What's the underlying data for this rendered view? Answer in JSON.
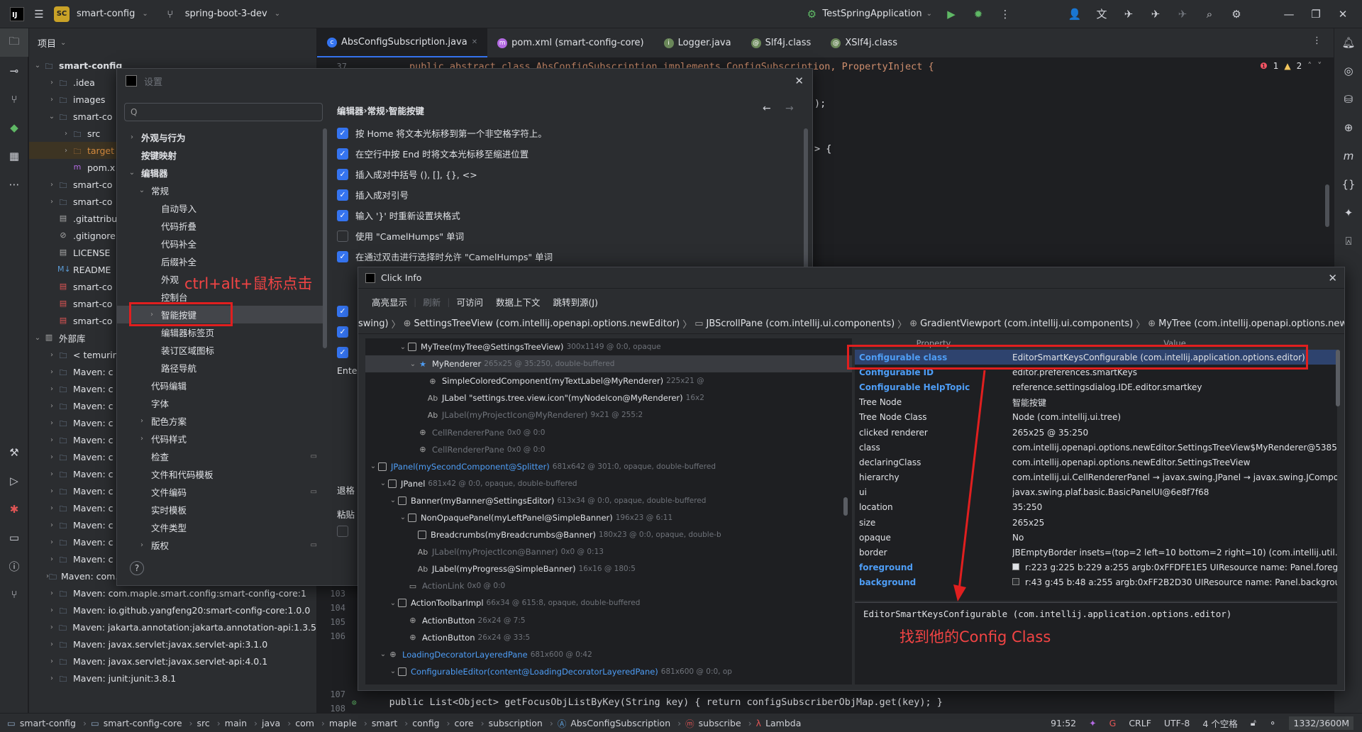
{
  "titlebar": {
    "project": "smart-config",
    "project_badge": "SC",
    "branch": "spring-boot-3-dev",
    "run_config": "TestSpringApplication"
  },
  "project_panel": {
    "title": "项目",
    "rows": [
      {
        "indent": 0,
        "arrow": "v",
        "icon": "folder",
        "label": "smart-config"
      },
      {
        "indent": 1,
        "arrow": ">",
        "icon": "folder",
        "label": ".idea"
      },
      {
        "indent": 1,
        "arrow": ">",
        "icon": "folder",
        "label": "images"
      },
      {
        "indent": 1,
        "arrow": "v",
        "icon": "folder",
        "label": "smart-co"
      },
      {
        "indent": 2,
        "arrow": ">",
        "icon": "folder",
        "label": "src"
      },
      {
        "indent": 2,
        "arrow": ">",
        "icon": "folder-orange",
        "label": "target"
      },
      {
        "indent": 2,
        "arrow": "",
        "icon": "maven",
        "label": "pom.x"
      },
      {
        "indent": 1,
        "arrow": ">",
        "icon": "folder",
        "label": "smart-co"
      },
      {
        "indent": 1,
        "arrow": ">",
        "icon": "folder",
        "label": "smart-co"
      },
      {
        "indent": 1,
        "arrow": "",
        "icon": "file",
        "label": ".gitattribu"
      },
      {
        "indent": 1,
        "arrow": "",
        "icon": "ignore",
        "label": ".gitignore"
      },
      {
        "indent": 1,
        "arrow": "",
        "icon": "file",
        "label": "LICENSE"
      },
      {
        "indent": 1,
        "arrow": "",
        "icon": "md",
        "label": "README"
      },
      {
        "indent": 1,
        "arrow": "",
        "icon": "file-red",
        "label": "smart-co"
      },
      {
        "indent": 1,
        "arrow": "",
        "icon": "file-red",
        "label": "smart-co"
      },
      {
        "indent": 1,
        "arrow": "",
        "icon": "file-red",
        "label": "smart-co"
      },
      {
        "indent": 0,
        "arrow": "v",
        "icon": "lib",
        "label": "外部库"
      },
      {
        "indent": 1,
        "arrow": ">",
        "icon": "folder",
        "label": "< temurin"
      },
      {
        "indent": 1,
        "arrow": ">",
        "icon": "folder",
        "label": "Maven: c"
      },
      {
        "indent": 1,
        "arrow": ">",
        "icon": "folder",
        "label": "Maven: c"
      },
      {
        "indent": 1,
        "arrow": ">",
        "icon": "folder",
        "label": "Maven: c"
      },
      {
        "indent": 1,
        "arrow": ">",
        "icon": "folder",
        "label": "Maven: c"
      },
      {
        "indent": 1,
        "arrow": ">",
        "icon": "folder",
        "label": "Maven: c"
      },
      {
        "indent": 1,
        "arrow": ">",
        "icon": "folder",
        "label": "Maven: c"
      },
      {
        "indent": 1,
        "arrow": ">",
        "icon": "folder",
        "label": "Maven: c"
      },
      {
        "indent": 1,
        "arrow": ">",
        "icon": "folder",
        "label": "Maven: c"
      },
      {
        "indent": 1,
        "arrow": ">",
        "icon": "folder",
        "label": "Maven: c"
      },
      {
        "indent": 1,
        "arrow": ">",
        "icon": "folder",
        "label": "Maven: c"
      },
      {
        "indent": 1,
        "arrow": ">",
        "icon": "folder",
        "label": "Maven: c"
      },
      {
        "indent": 1,
        "arrow": ">",
        "icon": "folder",
        "label": "Maven: c"
      },
      {
        "indent": 1,
        "arrow": ">",
        "icon": "folder",
        "label": "Maven: com.fasterxml.jackson.module:jackson-module-pa"
      },
      {
        "indent": 1,
        "arrow": ">",
        "icon": "folder",
        "label": "Maven: com.maple.smart.config:smart-config-core:1"
      },
      {
        "indent": 1,
        "arrow": ">",
        "icon": "folder",
        "label": "Maven: io.github.yangfeng20:smart-config-core:1.0.0"
      },
      {
        "indent": 1,
        "arrow": ">",
        "icon": "folder",
        "label": "Maven: jakarta.annotation:jakarta.annotation-api:1.3.5"
      },
      {
        "indent": 1,
        "arrow": ">",
        "icon": "folder",
        "label": "Maven: javax.servlet:javax.servlet-api:3.1.0"
      },
      {
        "indent": 1,
        "arrow": ">",
        "icon": "folder",
        "label": "Maven: javax.servlet:javax.servlet-api:4.0.1"
      },
      {
        "indent": 1,
        "arrow": ">",
        "icon": "folder",
        "label": "Maven: junit:junit:3.8.1"
      }
    ]
  },
  "editor": {
    "tabs": [
      {
        "label": "AbsConfigSubscription.java",
        "active": true,
        "color": "#3574f0",
        "glyph": "c"
      },
      {
        "label": "pom.xml (smart-config-core)",
        "active": false,
        "color": "#b36ae2",
        "glyph": "m"
      },
      {
        "label": "Logger.java",
        "active": false,
        "color": "#6a8759",
        "glyph": "i"
      },
      {
        "label": "Slf4j.class",
        "active": false,
        "color": "#6a8759",
        "glyph": "@"
      },
      {
        "label": "XSlf4j.class",
        "active": false,
        "color": "#6a8759",
        "glyph": "@"
      }
    ],
    "first_line_no": "37",
    "first_line": "public abstract class AbsConfigSubscription implements ConfigSubscription, PropertyInject {",
    "frag1": ");",
    "frag2": "> {",
    "inspection_errors": "1",
    "inspection_warnings": "2",
    "gutter_lines": [
      "103",
      "104",
      "105",
      "106",
      "",
      "107",
      "108"
    ],
    "last_line": "public List<Object> getFocusObjListByKey(String key) { return configSubscriberObjMap.get(key); }"
  },
  "statusbar": {
    "crumbs": [
      "smart-config",
      "smart-config-core",
      "src",
      "main",
      "java",
      "com",
      "maple",
      "smart",
      "config",
      "core",
      "subscription",
      "AbsConfigSubscription",
      "subscribe",
      "Lambda"
    ],
    "position": "91:52",
    "line_sep": "CRLF",
    "encoding": "UTF-8",
    "indent": "4 个空格",
    "memory": "1332/3600M"
  },
  "settings": {
    "title": "设置",
    "search_placeholder": "Q",
    "breadcrumb": [
      "编辑器",
      "常规",
      "智能按键"
    ],
    "tree": [
      {
        "indent": 0,
        "arrow": ">",
        "label": "外观与行为",
        "bold": true
      },
      {
        "indent": 0,
        "arrow": "",
        "label": "按键映射",
        "bold": true
      },
      {
        "indent": 0,
        "arrow": "v",
        "label": "编辑器",
        "bold": true
      },
      {
        "indent": 1,
        "arrow": "v",
        "label": "常规"
      },
      {
        "indent": 2,
        "arrow": "",
        "label": "自动导入"
      },
      {
        "indent": 2,
        "arrow": "",
        "label": "代码折叠"
      },
      {
        "indent": 2,
        "arrow": "",
        "label": "代码补全"
      },
      {
        "indent": 2,
        "arrow": "",
        "label": "后缀补全"
      },
      {
        "indent": 2,
        "arrow": "",
        "label": "外观"
      },
      {
        "indent": 2,
        "arrow": "",
        "label": "控制台"
      },
      {
        "indent": 2,
        "arrow": ">",
        "label": "智能按键",
        "selected": true
      },
      {
        "indent": 2,
        "arrow": "",
        "label": "编辑器标签页"
      },
      {
        "indent": 2,
        "arrow": "",
        "label": "装订区域图标"
      },
      {
        "indent": 2,
        "arrow": "",
        "label": "路径导航"
      },
      {
        "indent": 1,
        "arrow": "",
        "label": "代码编辑"
      },
      {
        "indent": 1,
        "arrow": "",
        "label": "字体"
      },
      {
        "indent": 1,
        "arrow": ">",
        "label": "配色方案"
      },
      {
        "indent": 1,
        "arrow": ">",
        "label": "代码样式"
      },
      {
        "indent": 1,
        "arrow": "",
        "label": "检查",
        "badge": true
      },
      {
        "indent": 1,
        "arrow": "",
        "label": "文件和代码模板"
      },
      {
        "indent": 1,
        "arrow": "",
        "label": "文件编码",
        "badge": true
      },
      {
        "indent": 1,
        "arrow": "",
        "label": "实时模板"
      },
      {
        "indent": 1,
        "arrow": "",
        "label": "文件类型"
      },
      {
        "indent": 1,
        "arrow": ">",
        "label": "版权",
        "badge": true
      }
    ],
    "options": [
      {
        "checked": true,
        "label": "按 Home 将文本光标移到第一个非空格字符上。"
      },
      {
        "checked": true,
        "label": "在空行中按 End 时将文本光标移至缩进位置"
      },
      {
        "checked": true,
        "label": "插入成对中括号 (), [], {}, <>"
      },
      {
        "checked": true,
        "label": "插入成对引号"
      },
      {
        "checked": true,
        "label": "输入 '}' 时重新设置块格式"
      },
      {
        "checked": false,
        "label": "使用 \"CamelHumps\" 单词"
      },
      {
        "checked": true,
        "label": "在通过双击进行选择时允许 \"CamelHumps\" 单词"
      }
    ],
    "partial_labels": [
      "Ente",
      "退格",
      "粘贴"
    ]
  },
  "annotation_click": "ctrl+alt+鼠标点击",
  "annotation_found": "找到他的Config Class",
  "clickinfo": {
    "title": "Click Info",
    "toolbar": [
      {
        "label": "高亮显示",
        "enabled": true
      },
      {
        "label": "刷新",
        "enabled": false
      },
      {
        "label": "可访问",
        "enabled": true
      },
      {
        "label": "数据上下文",
        "enabled": true
      },
      {
        "label": "跳转到源(J)",
        "enabled": true
      }
    ],
    "crumbs": [
      "swing)",
      "SettingsTreeView (com.intellij.openapi.options.newEditor)",
      "JBScrollPane (com.intellij.ui.components)",
      "GradientViewport (com.intellij.ui.components)",
      "MyTree (com.intellij.openapi.options.newEditor)"
    ],
    "tree": [
      {
        "indent": 14,
        "arrow": "v",
        "icon": "sq",
        "name": "MyTree(myTree@SettingsTreeView)",
        "detail": "300x1149 @ 0:0, opaque"
      },
      {
        "indent": 15,
        "arrow": "v",
        "icon": "star",
        "name": "MyRenderer",
        "detail": "265x25 @ 35:250, double-buffered",
        "selected": true
      },
      {
        "indent": 16,
        "arrow": "",
        "icon": "glob",
        "name": "SimpleColoredComponent(myTextLabel@MyRenderer)",
        "detail": "225x21 @"
      },
      {
        "indent": 16,
        "arrow": "",
        "icon": "ab",
        "name": "JLabel \"settings.tree.view.icon\"(myNodeIcon@MyRenderer)",
        "detail": "16x2"
      },
      {
        "indent": 16,
        "arrow": "",
        "icon": "ab",
        "name": "JLabel(myProjectIcon@MyRenderer)",
        "detail": "9x21 @ 255:2",
        "dim": true
      },
      {
        "indent": 15,
        "arrow": "",
        "icon": "glob",
        "name": "CellRendererPane",
        "detail": "0x0 @ 0:0",
        "dim": true
      },
      {
        "indent": 15,
        "arrow": "",
        "icon": "glob",
        "name": "CellRendererPane",
        "detail": "0x0 @ 0:0",
        "dim": true
      },
      {
        "indent": 11,
        "arrow": "v",
        "icon": "sq",
        "name": "JPanel(mySecondComponent@Splitter)",
        "detail": "681x642 @ 301:0, opaque, double-buffered",
        "blue": true
      },
      {
        "indent": 12,
        "arrow": "v",
        "icon": "sq",
        "name": "JPanel",
        "detail": "681x42 @ 0:0, opaque, double-buffered"
      },
      {
        "indent": 13,
        "arrow": "v",
        "icon": "sq",
        "name": "Banner(myBanner@SettingsEditor)",
        "detail": "613x34 @ 0:0, opaque, double-buffered"
      },
      {
        "indent": 14,
        "arrow": "v",
        "icon": "sq",
        "name": "NonOpaquePanel(myLeftPanel@SimpleBanner)",
        "detail": "196x23 @ 6:11"
      },
      {
        "indent": 15,
        "arrow": "",
        "icon": "sq",
        "name": "Breadcrumbs(myBreadcrumbs@Banner)",
        "detail": "180x23 @ 0:0, opaque, double-b"
      },
      {
        "indent": 15,
        "arrow": "",
        "icon": "ab",
        "name": "JLabel(myProjectIcon@Banner)",
        "detail": "0x0 @ 0:13",
        "dim": true
      },
      {
        "indent": 15,
        "arrow": "",
        "icon": "ab",
        "name": "JLabel(myProgress@SimpleBanner)",
        "detail": "16x16 @ 180:5"
      },
      {
        "indent": 14,
        "arrow": "",
        "icon": "sq2",
        "name": "ActionLink",
        "detail": "0x0 @ 0:0",
        "dim": true
      },
      {
        "indent": 13,
        "arrow": "v",
        "icon": "sq",
        "name": "ActionToolbarImpl",
        "detail": "66x34 @ 615:8, opaque, double-buffered"
      },
      {
        "indent": 14,
        "arrow": "",
        "icon": "glob",
        "name": "ActionButton",
        "detail": "26x24 @ 7:5"
      },
      {
        "indent": 14,
        "arrow": "",
        "icon": "glob",
        "name": "ActionButton",
        "detail": "26x24 @ 33:5"
      },
      {
        "indent": 12,
        "arrow": "v",
        "icon": "glob",
        "name": "LoadingDecoratorLayeredPane",
        "detail": "681x600 @ 0:42",
        "blue": true
      },
      {
        "indent": 13,
        "arrow": "v",
        "icon": "sq",
        "name": "ConfigurableEditor(content@LoadingDecoratorLayeredPane)",
        "detail": "681x600 @ 0:0, op",
        "blue": true
      },
      {
        "indent": 14,
        "arrow": "",
        "icon": "ab",
        "name": "JLabel(myErrorLabel@ConfigurableEditor)",
        "detail": "0x0 @ 0:0",
        "dim": true
      }
    ],
    "props_header": [
      "Property",
      "Value"
    ],
    "props": [
      {
        "k": "Configurable class",
        "v": "EditorSmartKeysConfigurable (com.intellij.application.options.editor)",
        "blue": true,
        "selected": true
      },
      {
        "k": "Configurable ID",
        "v": "editor.preferences.smartKeys",
        "blue": true
      },
      {
        "k": "Configurable HelpTopic",
        "v": "reference.settingsdialog.IDE.editor.smartkey",
        "blue": true
      },
      {
        "k": "Tree Node",
        "v": "智能按键"
      },
      {
        "k": "Tree Node Class",
        "v": "Node (com.intellij.ui.tree)"
      },
      {
        "k": "clicked renderer",
        "v": "265x25 @ 35:250"
      },
      {
        "k": "class",
        "v": "com.intellij.openapi.options.newEditor.SettingsTreeView$MyRenderer@5385..."
      },
      {
        "k": "declaringClass",
        "v": "com.intellij.openapi.options.newEditor.SettingsTreeView"
      },
      {
        "k": "hierarchy",
        "v": "com.intellij.ui.CellRendererPanel → javax.swing.JPanel → javax.swing.JCompo..."
      },
      {
        "k": "ui",
        "v": "javax.swing.plaf.basic.BasicPanelUI@6e8f7f68"
      },
      {
        "k": "location",
        "v": "35:250"
      },
      {
        "k": "size",
        "v": "265x25"
      },
      {
        "k": "opaque",
        "v": "No"
      },
      {
        "k": "border",
        "v": "JBEmptyBorder insets=(top=2 left=10 bottom=2 right=10) (com.intellij.util.ui...."
      },
      {
        "k": "foreground",
        "v": "r:223 g:225 b:229 a:255 argb:0xFFDFE1E5 UIResource name: Panel.foregr...",
        "blue": true,
        "swatch": "#dfe1e5"
      },
      {
        "k": "background",
        "v": "r:43 g:45 b:48 a:255 argb:0xFF2B2D30 UIResource name: Panel.backgrou...",
        "blue": true,
        "swatch": "#2b2d30"
      }
    ],
    "desc": "EditorSmartKeysConfigurable (com.intellij.application.options.editor)"
  }
}
